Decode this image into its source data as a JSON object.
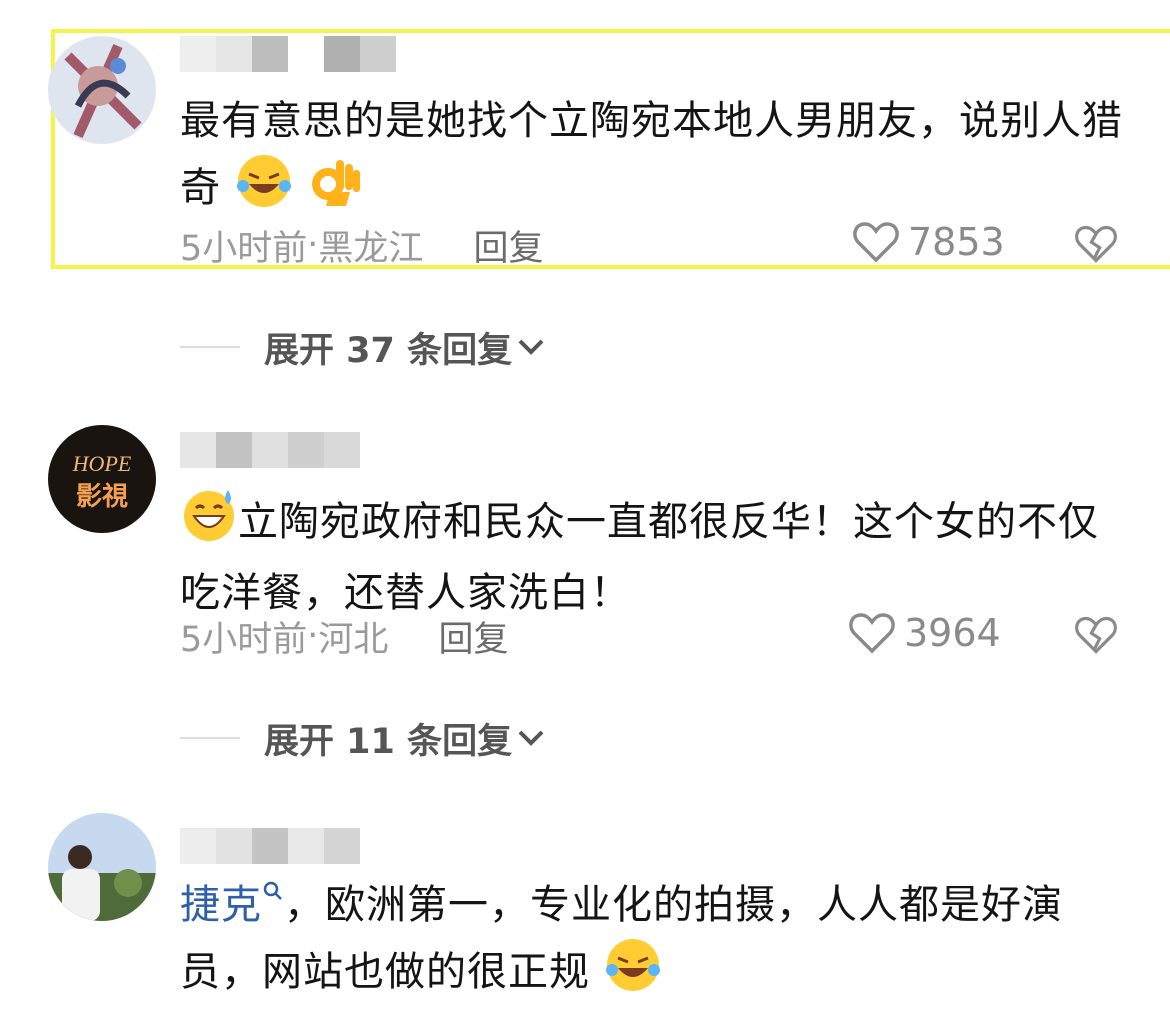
{
  "comments": [
    {
      "text": "最有意思的是她找个立陶宛本地人男朋友，说别人猎奇",
      "time": "5小时前",
      "location": "黑龙江",
      "reply_label": "回复",
      "likes": "7853",
      "expand_label": "展开 37 条回复",
      "emojis": [
        "laughing-tears",
        "ok-hand"
      ]
    },
    {
      "text_prefix_emoji": "sweat-smile",
      "text": "立陶宛政府和民众一直都很反华！这个女的不仅吃洋餐，还替人家洗白！",
      "time": "5小时前",
      "location": "河北",
      "reply_label": "回复",
      "likes": "3964",
      "expand_label": "展开 11 条回复",
      "avatar_text": "HOPE 影视"
    },
    {
      "hashtag": "捷克",
      "text": "，欧洲第一，专业化的拍摄，人人都是好演员，网站也做的很正规",
      "emojis": [
        "laughing-tears"
      ]
    }
  ],
  "colors": {
    "highlight": "#f4f54a",
    "meta": "#9a9a9a",
    "hashtag": "#2f5eaa"
  }
}
